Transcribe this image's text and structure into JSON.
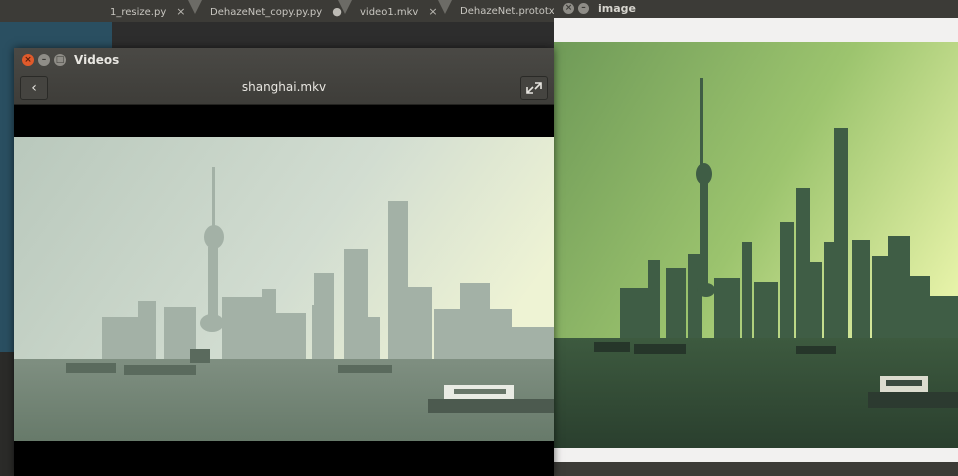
{
  "editor": {
    "tabs": [
      {
        "label": "1_resize.py",
        "marker": "×"
      },
      {
        "label": "DehazeNet_copy.py.py",
        "marker": "●"
      },
      {
        "label": "video1.mkv",
        "marker": "×"
      },
      {
        "label": "DehazeNet.prototxt",
        "marker": ""
      }
    ]
  },
  "image_window": {
    "title": "image",
    "close_glyph": "×",
    "min_glyph": "–"
  },
  "videos_window": {
    "title": "Videos",
    "file_title": "shanghai.mkv",
    "back_glyph": "‹",
    "close_glyph": "×",
    "min_glyph": "–",
    "max_glyph": "□"
  },
  "colors": {
    "window_chrome": "#3c3b37",
    "close_accent": "#e05a2b",
    "hazy_sky": "#cfd8cf",
    "dehazed_sky": "#a9cc6e"
  },
  "icons": [
    "close-icon",
    "minimize-icon",
    "maximize-icon",
    "back-arrow-icon",
    "fullscreen-icon"
  ]
}
